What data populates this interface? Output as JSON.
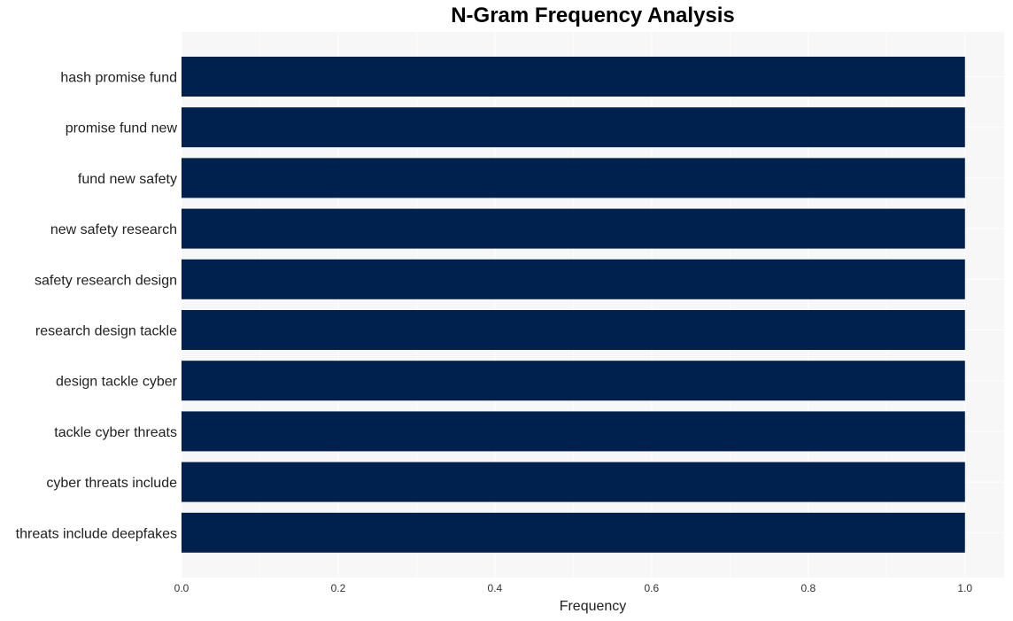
{
  "chart_data": {
    "type": "bar",
    "orientation": "horizontal",
    "title": "N-Gram Frequency Analysis",
    "xlabel": "Frequency",
    "ylabel": "",
    "categories": [
      "hash promise fund",
      "promise fund new",
      "fund new safety",
      "new safety research",
      "safety research design",
      "research design tackle",
      "design tackle cyber",
      "tackle cyber threats",
      "cyber threats include",
      "threats include deepfakes"
    ],
    "values": [
      1,
      1,
      1,
      1,
      1,
      1,
      1,
      1,
      1,
      1
    ],
    "xlim": [
      0,
      1.05
    ],
    "xticks": [
      "0.0",
      "0.2",
      "0.4",
      "0.6",
      "0.8",
      "1.0"
    ],
    "grid": true,
    "legend": "none",
    "colors": {
      "bar": "#00204e",
      "plot_bg": "#f7f7f7",
      "grid": "#ffffff"
    }
  }
}
